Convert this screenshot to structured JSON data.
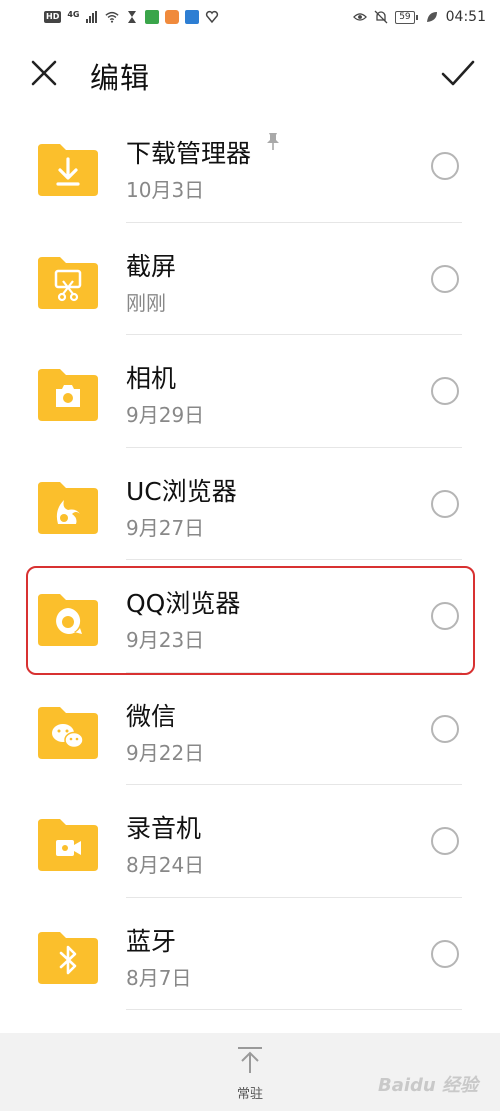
{
  "status_bar": {
    "hd": "HD",
    "network": "4G",
    "time": "04:51",
    "battery": "59"
  },
  "header": {
    "title": "编辑"
  },
  "folders": [
    {
      "name": "下载管理器",
      "date": "10月3日",
      "icon": "download-icon",
      "pinned": true
    },
    {
      "name": "截屏",
      "date": "刚刚",
      "icon": "screenshot-icon"
    },
    {
      "name": "相机",
      "date": "9月29日",
      "icon": "camera-icon"
    },
    {
      "name": "UC浏览器",
      "date": "9月27日",
      "icon": "uc-browser-icon"
    },
    {
      "name": "QQ浏览器",
      "date": "9月23日",
      "icon": "qq-browser-icon"
    },
    {
      "name": "微信",
      "date": "9月22日",
      "icon": "wechat-icon",
      "highlighted": true
    },
    {
      "name": "录音机",
      "date": "8月24日",
      "icon": "recorder-icon"
    },
    {
      "name": "蓝牙",
      "date": "8月7日",
      "icon": "bluetooth-icon"
    }
  ],
  "bottom_bar": {
    "pin_label": "常驻"
  },
  "watermark": "Baidu 经验",
  "colors": {
    "folder": "#fbbf2c",
    "highlight": "#d83131",
    "radio": "#b5b5b5"
  }
}
